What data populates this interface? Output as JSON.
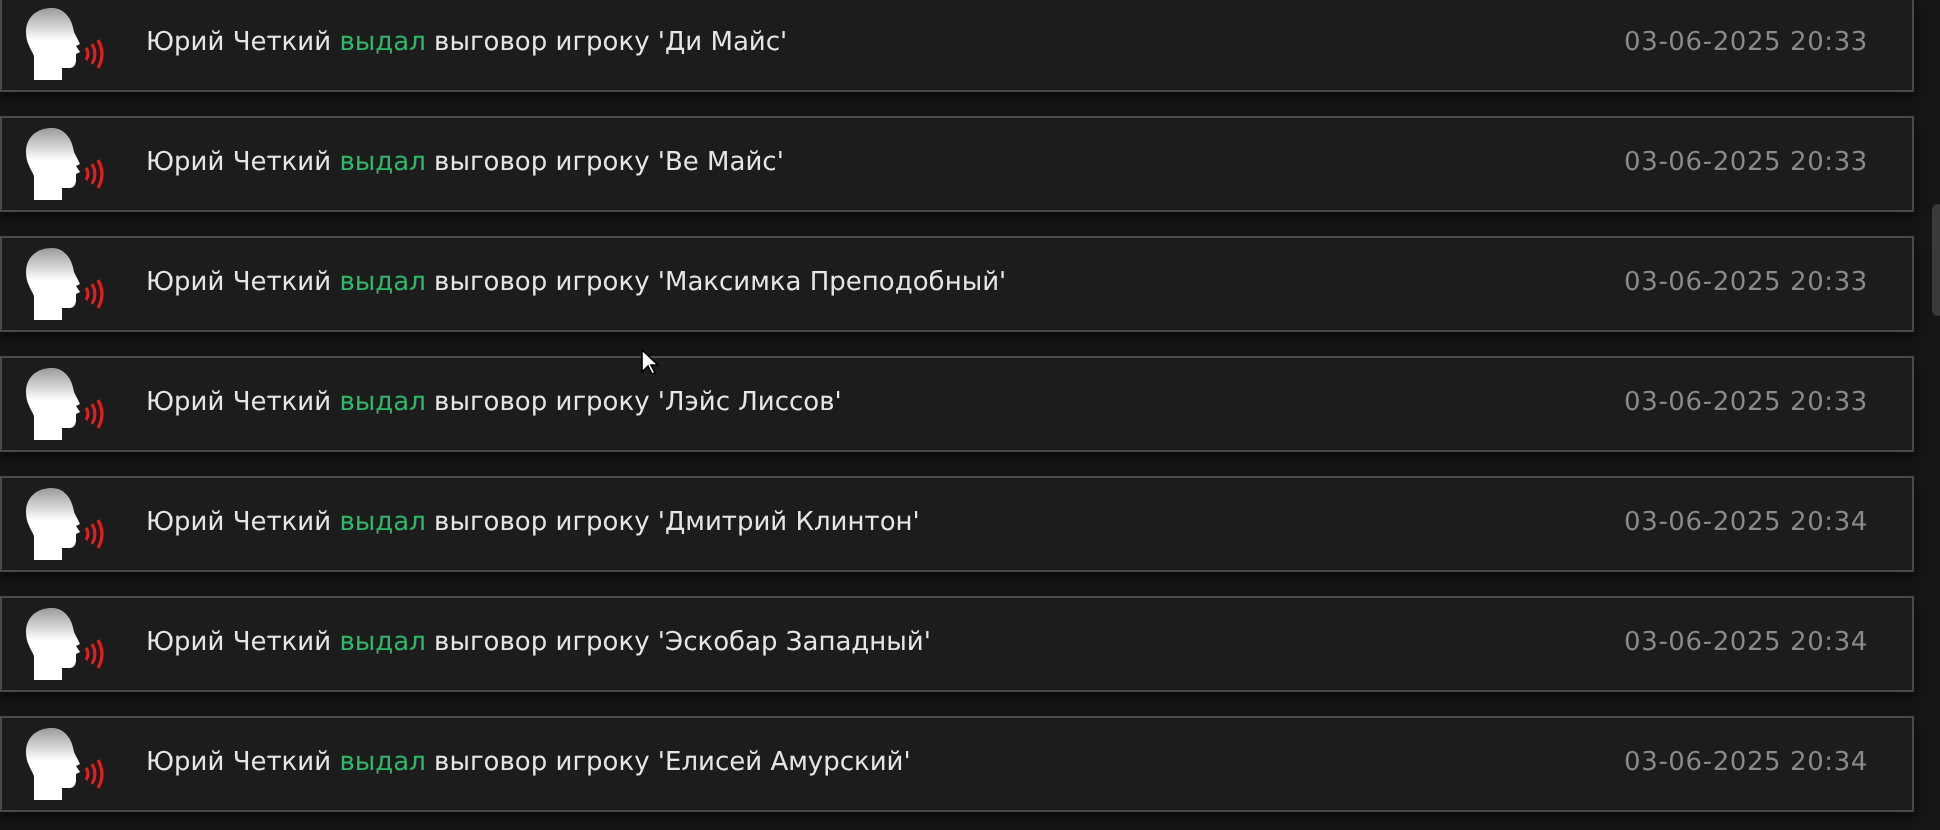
{
  "log": [
    {
      "actor": "Юрий Четкий",
      "action": "выдал",
      "text": "выговор игроку 'Ди Майс'",
      "time": "03-06-2025 20:33"
    },
    {
      "actor": "Юрий Четкий",
      "action": "выдал",
      "text": "выговор игроку 'Ве Майс'",
      "time": "03-06-2025 20:33"
    },
    {
      "actor": "Юрий Четкий",
      "action": "выдал",
      "text": "выговор игроку 'Максимка Преподобный'",
      "time": "03-06-2025 20:33"
    },
    {
      "actor": "Юрий Четкий",
      "action": "выдал",
      "text": "выговор игроку 'Лэйс Лиссов'",
      "time": "03-06-2025 20:33"
    },
    {
      "actor": "Юрий Четкий",
      "action": "выдал",
      "text": "выговор игроку 'Дмитрий Клинтон'",
      "time": "03-06-2025 20:34"
    },
    {
      "actor": "Юрий Четкий",
      "action": "выдал",
      "text": "выговор игроку 'Эскобар Западный'",
      "time": "03-06-2025 20:34"
    },
    {
      "actor": "Юрий Четкий",
      "action": "выдал",
      "text": "выговор игроку 'Елисей Амурский'",
      "time": "03-06-2025 20:34"
    }
  ]
}
